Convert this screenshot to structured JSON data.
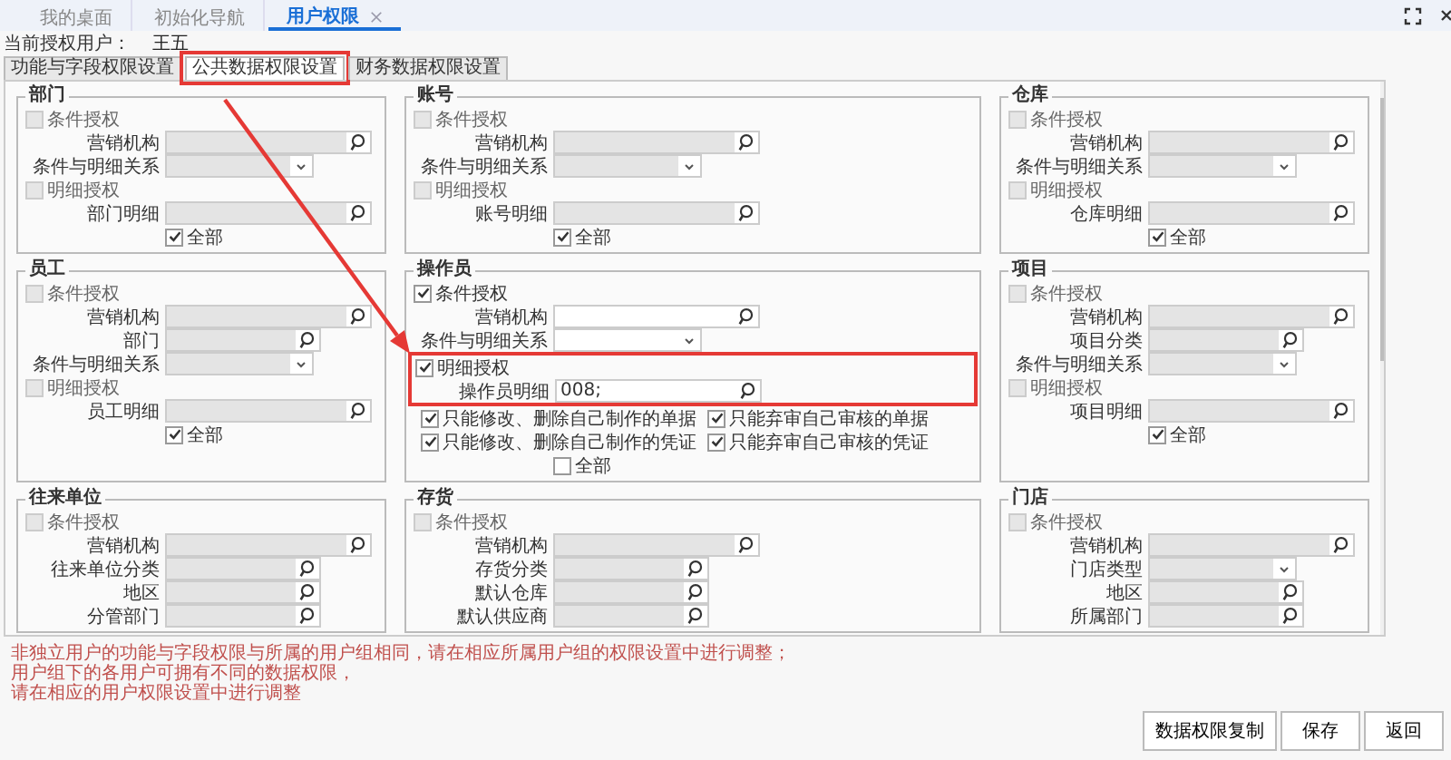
{
  "tabs": [
    {
      "label": "我的桌面",
      "selected": false,
      "closable": false
    },
    {
      "label": "初始化导航",
      "selected": false,
      "closable": false
    },
    {
      "label": "用户权限",
      "selected": true,
      "closable": true
    }
  ],
  "current_user": {
    "label": "当前授权用户：",
    "value": "王五"
  },
  "subtabs": [
    {
      "label": "功能与字段权限设置",
      "selected": false,
      "highlighted": false
    },
    {
      "label": "公共数据权限设置",
      "selected": true,
      "highlighted": true
    },
    {
      "label": "财务数据权限设置",
      "selected": false,
      "highlighted": false
    }
  ],
  "sections": [
    {
      "title": "部门",
      "items": [
        {
          "kind": "check",
          "label": "条件授权",
          "checked": false,
          "disabled": true
        },
        {
          "kind": "lookup",
          "label": "营销机构",
          "disabled": true
        },
        {
          "kind": "select",
          "label": "条件与明细关系",
          "disabled": true
        },
        {
          "kind": "check",
          "label": "明细授权",
          "checked": false,
          "disabled": true
        },
        {
          "kind": "lookup",
          "label": "部门明细",
          "disabled": true
        },
        {
          "kind": "all",
          "label": "全部",
          "checked": true
        }
      ]
    },
    {
      "title": "账号",
      "items": [
        {
          "kind": "check",
          "label": "条件授权",
          "checked": false,
          "disabled": true
        },
        {
          "kind": "lookup",
          "label": "营销机构",
          "disabled": true
        },
        {
          "kind": "select",
          "label": "条件与明细关系",
          "disabled": true
        },
        {
          "kind": "check",
          "label": "明细授权",
          "checked": false,
          "disabled": true
        },
        {
          "kind": "lookup",
          "label": "账号明细",
          "disabled": true
        },
        {
          "kind": "all",
          "label": "全部",
          "checked": true
        }
      ]
    },
    {
      "title": "仓库",
      "items": [
        {
          "kind": "check",
          "label": "条件授权",
          "checked": false,
          "disabled": true
        },
        {
          "kind": "lookup",
          "label": "营销机构",
          "disabled": true
        },
        {
          "kind": "select",
          "label": "条件与明细关系",
          "disabled": true
        },
        {
          "kind": "check",
          "label": "明细授权",
          "checked": false,
          "disabled": true
        },
        {
          "kind": "lookup",
          "label": "仓库明细",
          "disabled": true
        },
        {
          "kind": "all",
          "label": "全部",
          "checked": true
        }
      ]
    },
    {
      "title": "员工",
      "items": [
        {
          "kind": "check",
          "label": "条件授权",
          "checked": false,
          "disabled": true
        },
        {
          "kind": "lookup",
          "label": "营销机构",
          "disabled": true
        },
        {
          "kind": "lookup_short",
          "label": "部门",
          "disabled": true
        },
        {
          "kind": "select",
          "label": "条件与明细关系",
          "disabled": true
        },
        {
          "kind": "check",
          "label": "明细授权",
          "checked": false,
          "disabled": true
        },
        {
          "kind": "lookup",
          "label": "员工明细",
          "disabled": true
        },
        {
          "kind": "all",
          "label": "全部",
          "checked": true
        }
      ]
    },
    {
      "title": "操作员",
      "items": [
        {
          "kind": "check",
          "label": "条件授权",
          "checked": true,
          "disabled": false
        },
        {
          "kind": "lookup",
          "label": "营销机构",
          "disabled": false
        },
        {
          "kind": "select",
          "label": "条件与明细关系",
          "disabled": false
        },
        {
          "kind": "group",
          "highlighted": true,
          "items": [
            {
              "kind": "check",
              "label": "明细授权",
              "checked": true,
              "disabled": false
            },
            {
              "kind": "lookup",
              "label": "操作员明细",
              "value": "008;",
              "disabled": false
            }
          ]
        },
        {
          "kind": "pair",
          "checks": [
            {
              "label": "只能修改、删除自己制作的单据",
              "checked": true
            },
            {
              "label": "只能弃审自己审核的单据",
              "checked": true
            }
          ]
        },
        {
          "kind": "pair",
          "checks": [
            {
              "label": "只能修改、删除自己制作的凭证",
              "checked": true
            },
            {
              "label": "只能弃审自己审核的凭证",
              "checked": true
            }
          ]
        },
        {
          "kind": "all",
          "label": "全部",
          "checked": false
        }
      ]
    },
    {
      "title": "项目",
      "items": [
        {
          "kind": "check",
          "label": "条件授权",
          "checked": false,
          "disabled": true
        },
        {
          "kind": "lookup",
          "label": "营销机构",
          "disabled": true
        },
        {
          "kind": "lookup_short",
          "label": "项目分类",
          "disabled": true
        },
        {
          "kind": "select",
          "label": "条件与明细关系",
          "disabled": true
        },
        {
          "kind": "check",
          "label": "明细授权",
          "checked": false,
          "disabled": true
        },
        {
          "kind": "lookup",
          "label": "项目明细",
          "disabled": true
        },
        {
          "kind": "all",
          "label": "全部",
          "checked": true
        }
      ]
    },
    {
      "title": "往来单位",
      "items": [
        {
          "kind": "check",
          "label": "条件授权",
          "checked": false,
          "disabled": true
        },
        {
          "kind": "lookup",
          "label": "营销机构",
          "disabled": true
        },
        {
          "kind": "lookup_short",
          "label": "往来单位分类",
          "disabled": true
        },
        {
          "kind": "lookup_short",
          "label": "地区",
          "disabled": true
        },
        {
          "kind": "lookup_short",
          "label": "分管部门",
          "disabled": true
        }
      ]
    },
    {
      "title": "存货",
      "items": [
        {
          "kind": "check",
          "label": "条件授权",
          "checked": false,
          "disabled": true
        },
        {
          "kind": "lookup",
          "label": "营销机构",
          "disabled": true
        },
        {
          "kind": "lookup_short",
          "label": "存货分类",
          "disabled": true
        },
        {
          "kind": "lookup_short",
          "label": "默认仓库",
          "disabled": true
        },
        {
          "kind": "lookup_short",
          "label": "默认供应商",
          "disabled": true
        }
      ]
    },
    {
      "title": "门店",
      "items": [
        {
          "kind": "check",
          "label": "条件授权",
          "checked": false,
          "disabled": true
        },
        {
          "kind": "lookup",
          "label": "营销机构",
          "disabled": true
        },
        {
          "kind": "select",
          "label": "门店类型",
          "disabled": true
        },
        {
          "kind": "lookup_short",
          "label": "地区",
          "disabled": true
        },
        {
          "kind": "lookup_short",
          "label": "所属部门",
          "disabled": true
        }
      ]
    }
  ],
  "notes": [
    "非独立用户的功能与字段权限与所属的用户组相同，请在相应所属用户组的权限设置中进行调整；",
    "用户组下的各用户可拥有不同的数据权限，",
    "请在相应的用户权限设置中进行调整"
  ],
  "buttons": [
    "数据权限复制",
    "保存",
    "返回"
  ]
}
